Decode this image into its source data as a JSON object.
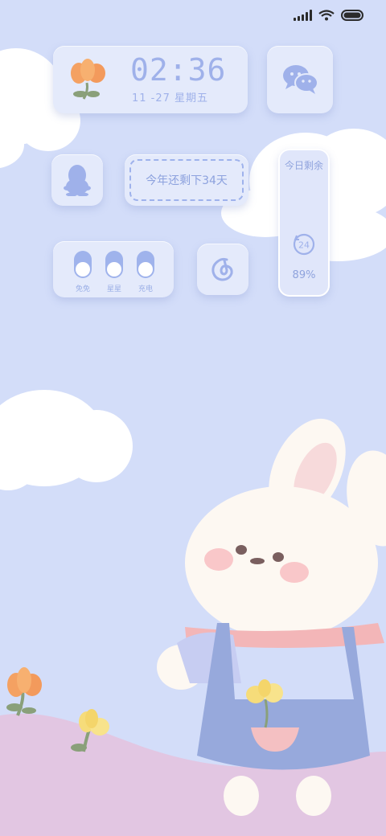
{
  "status_bar": {
    "signal_icon": "cellular-signal-icon",
    "wifi_icon": "wifi-icon",
    "battery_icon": "battery-icon"
  },
  "clock_widget": {
    "time": "02:36",
    "date": "11 -27 星期五",
    "icon": "tulip-icon"
  },
  "wechat_widget": {
    "icon": "wechat-icon"
  },
  "qq_widget": {
    "icon": "qq-penguin-icon"
  },
  "countdown_widget": {
    "text": "今年还剩下34天"
  },
  "battery_widget": {
    "title": "今日剩余",
    "icon": "clock-24-icon",
    "percent_label": "89%",
    "percent": 0.89
  },
  "toggles_widget": {
    "toggles": [
      {
        "label": "免免"
      },
      {
        "label": "星星"
      },
      {
        "label": "充电"
      }
    ]
  },
  "netease_widget": {
    "icon": "netease-music-icon"
  },
  "colors": {
    "background": "#d3ddf9",
    "widget": "#e4eafb",
    "accent": "#9fb1ea",
    "cloud": "#ffffff",
    "ground": "#e2c6e2"
  }
}
